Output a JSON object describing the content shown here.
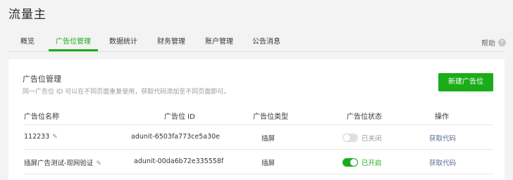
{
  "app": {
    "title": "流量主"
  },
  "nav": {
    "tabs": [
      {
        "label": "概览"
      },
      {
        "label": "广告位管理",
        "active": true
      },
      {
        "label": "数据统计"
      },
      {
        "label": "财务管理"
      },
      {
        "label": "账户管理"
      },
      {
        "label": "公告消息"
      }
    ],
    "help_label": "帮助",
    "help_icon": "?"
  },
  "card": {
    "title": "广告位管理",
    "description": "同一广告位 ID 可以在不同页面重复使用，获取代码添加至不同页面即可。",
    "new_button_label": "新建广告位"
  },
  "table": {
    "headers": [
      "广告位名称",
      "广告位 ID",
      "广告位类型",
      "广告位状态",
      "操作"
    ],
    "rows": [
      {
        "name": "112233",
        "id": "adunit-6503fa773ce5a30e",
        "type": "插屏",
        "enabled": false,
        "status": "已关闭",
        "action": "获取代码"
      },
      {
        "name": "插屏广告测试-现网验证",
        "id": "adunit-00da6b72e335558f",
        "type": "插屏",
        "enabled": true,
        "status": "已开启",
        "action": "获取代码"
      }
    ]
  },
  "colors": {
    "accent": "#1aad19",
    "link": "#576b95",
    "background": "#f3f3f3"
  }
}
